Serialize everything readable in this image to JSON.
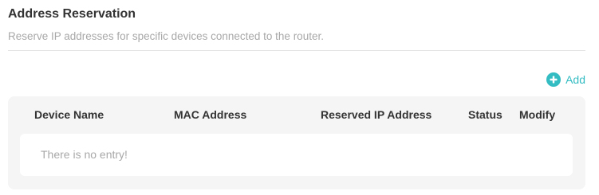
{
  "section": {
    "title": "Address Reservation",
    "description": "Reserve IP addresses for specific devices connected to the router."
  },
  "toolbar": {
    "add_label": "Add",
    "add_icon": "plus-circle-icon",
    "accent_color": "#33bcc2"
  },
  "table": {
    "columns": [
      "Device Name",
      "MAC Address",
      "Reserved IP Address",
      "Status",
      "Modify"
    ],
    "rows": [],
    "empty_message": "There is no entry!"
  }
}
